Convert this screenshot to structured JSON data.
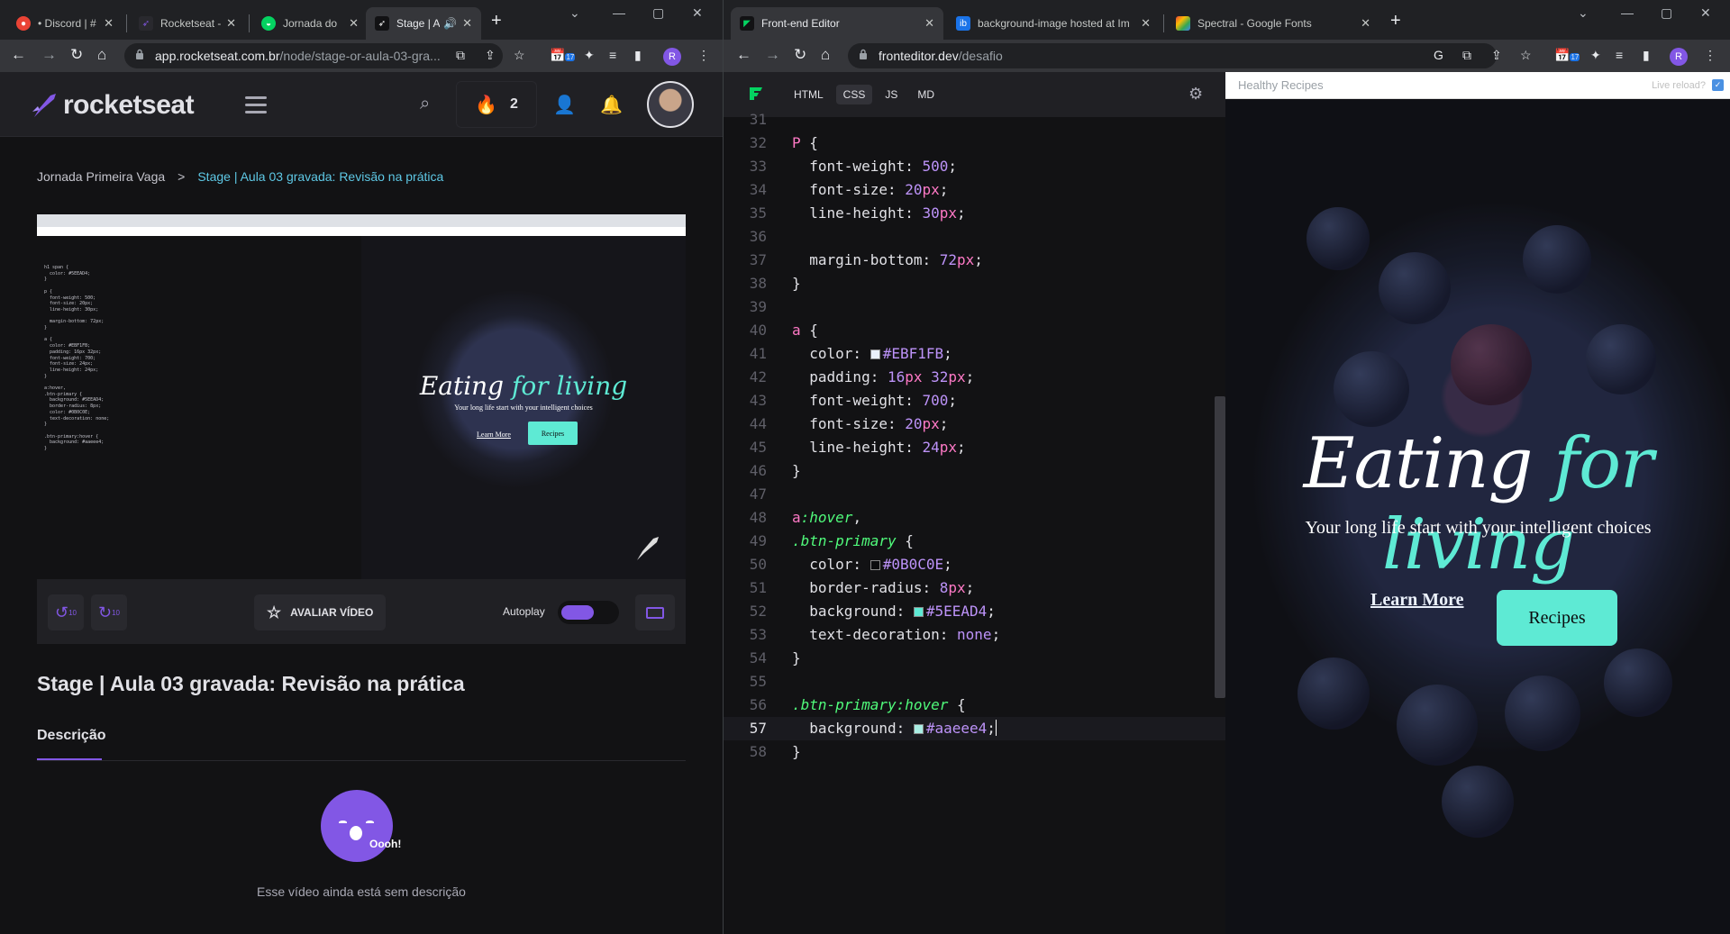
{
  "left_window": {
    "tabs": [
      {
        "title": "• Discord | #"
      },
      {
        "title": "Rocketseat -"
      },
      {
        "title": "Jornada do"
      },
      {
        "title": "Stage | A"
      }
    ],
    "url_host": "app.rocketseat.com.br",
    "url_path": "/node/stage-or-aula-03-gra...",
    "profile_initial": "R",
    "ext_badge": "17"
  },
  "rocketseat": {
    "logo": "rocketseat",
    "streak_count": "2",
    "breadcrumb": {
      "parent": "Jornada Primeira Vaga",
      "separator": ">",
      "current": "Stage | Aula 03 gravada: Revisão na prática"
    },
    "player": {
      "rate_label": "AVALIAR VÍDEO",
      "autoplay_label": "Autoplay",
      "rewind_label": "10",
      "forward_label": "10",
      "mini": {
        "hero_a": "Eating ",
        "hero_b": "for living",
        "sub": "Your long life start with your intelligent choices",
        "learn": "Learn More",
        "recipes": "Recipes",
        "code": "h1 span {\n  color: #5EEAD4;\n}\n\np {\n  font-weight: 500;\n  font-size: 20px;\n  line-height: 30px;\n\n  margin-bottom: 72px;\n}\n\na {\n  color: #EBF1FB;\n  padding: 16px 32px;\n  font-weight: 700;\n  font-size: 24px;\n  line-height: 24px;\n}\n\na:hover,\n.btn-primary {\n  background: #5EEAD4;\n  border-radius: 8px;\n  color: #0B0C0E;\n  text-decoration: none;\n}\n\n.btn-primary:hover {\n  background: #aaeee4;\n}"
      }
    },
    "lesson_title": "Stage | Aula 03 gravada: Revisão na prática",
    "description_tab": "Descrição",
    "mascot_text": "Oooh!",
    "no_description": "Esse vídeo ainda está sem descrição"
  },
  "right_window": {
    "tabs": [
      {
        "title": "Front-end Editor"
      },
      {
        "title": "background-image hosted at Im"
      },
      {
        "title": "Spectral - Google Fonts"
      }
    ],
    "url_host": "fronteditor.dev",
    "url_path": "/desafio",
    "profile_initial": "R",
    "ext_badge": "17"
  },
  "editor": {
    "tabs": [
      "HTML",
      "CSS",
      "JS",
      "MD"
    ],
    "active_tab": "CSS",
    "lines": [
      {
        "n": "31",
        "parts": []
      },
      {
        "n": "32",
        "parts": [
          {
            "t": "P ",
            "c": "sel"
          },
          {
            "t": "{",
            "c": ""
          }
        ]
      },
      {
        "n": "33",
        "parts": [
          {
            "t": "  font-weight: ",
            "c": "prop"
          },
          {
            "t": "500",
            "c": "num"
          },
          {
            "t": ";",
            "c": ""
          }
        ]
      },
      {
        "n": "34",
        "parts": [
          {
            "t": "  font-size: ",
            "c": "prop"
          },
          {
            "t": "20",
            "c": "num"
          },
          {
            "t": "px",
            "c": "unit"
          },
          {
            "t": ";",
            "c": ""
          }
        ]
      },
      {
        "n": "35",
        "parts": [
          {
            "t": "  line-height: ",
            "c": "prop"
          },
          {
            "t": "30",
            "c": "num"
          },
          {
            "t": "px",
            "c": "unit"
          },
          {
            "t": ";",
            "c": ""
          }
        ]
      },
      {
        "n": "36",
        "parts": []
      },
      {
        "n": "37",
        "parts": [
          {
            "t": "  margin-bottom: ",
            "c": "prop"
          },
          {
            "t": "72",
            "c": "num"
          },
          {
            "t": "px",
            "c": "unit"
          },
          {
            "t": ";",
            "c": ""
          }
        ]
      },
      {
        "n": "38",
        "parts": [
          {
            "t": "}",
            "c": ""
          }
        ]
      },
      {
        "n": "39",
        "parts": []
      },
      {
        "n": "40",
        "parts": [
          {
            "t": "a ",
            "c": "sel"
          },
          {
            "t": "{",
            "c": ""
          }
        ]
      },
      {
        "n": "41",
        "parts": [
          {
            "t": "  color: ",
            "c": "prop"
          },
          {
            "sw": "#EBF1FB"
          },
          {
            "t": "#EBF1FB",
            "c": "val"
          },
          {
            "t": ";",
            "c": ""
          }
        ]
      },
      {
        "n": "42",
        "parts": [
          {
            "t": "  padding: ",
            "c": "prop"
          },
          {
            "t": "16",
            "c": "num"
          },
          {
            "t": "px ",
            "c": "unit"
          },
          {
            "t": "32",
            "c": "num"
          },
          {
            "t": "px",
            "c": "unit"
          },
          {
            "t": ";",
            "c": ""
          }
        ]
      },
      {
        "n": "43",
        "parts": [
          {
            "t": "  font-weight: ",
            "c": "prop"
          },
          {
            "t": "700",
            "c": "num"
          },
          {
            "t": ";",
            "c": ""
          }
        ]
      },
      {
        "n": "44",
        "parts": [
          {
            "t": "  font-size: ",
            "c": "prop"
          },
          {
            "t": "20",
            "c": "num"
          },
          {
            "t": "px",
            "c": "unit"
          },
          {
            "t": ";",
            "c": ""
          }
        ]
      },
      {
        "n": "45",
        "parts": [
          {
            "t": "  line-height: ",
            "c": "prop"
          },
          {
            "t": "24",
            "c": "num"
          },
          {
            "t": "px",
            "c": "unit"
          },
          {
            "t": ";",
            "c": ""
          }
        ]
      },
      {
        "n": "46",
        "parts": [
          {
            "t": "}",
            "c": ""
          }
        ]
      },
      {
        "n": "47",
        "parts": []
      },
      {
        "n": "48",
        "parts": [
          {
            "t": "a",
            "c": "sel"
          },
          {
            "t": ":hover",
            "c": "sel-i"
          },
          {
            "t": ",",
            "c": ""
          }
        ]
      },
      {
        "n": "49",
        "parts": [
          {
            "t": ".btn-primary",
            "c": "sel-i"
          },
          {
            "t": " {",
            "c": ""
          }
        ]
      },
      {
        "n": "50",
        "parts": [
          {
            "t": "  color: ",
            "c": "prop"
          },
          {
            "sw": "#0B0C0E"
          },
          {
            "t": "#0B0C0E",
            "c": "val"
          },
          {
            "t": ";",
            "c": ""
          }
        ]
      },
      {
        "n": "51",
        "parts": [
          {
            "t": "  border-radius: ",
            "c": "prop"
          },
          {
            "t": "8",
            "c": "num"
          },
          {
            "t": "px",
            "c": "unit"
          },
          {
            "t": ";",
            "c": ""
          }
        ]
      },
      {
        "n": "52",
        "parts": [
          {
            "t": "  background: ",
            "c": "prop"
          },
          {
            "sw": "#5EEAD4"
          },
          {
            "t": "#5EEAD4",
            "c": "val"
          },
          {
            "t": ";",
            "c": ""
          }
        ]
      },
      {
        "n": "53",
        "parts": [
          {
            "t": "  text-decoration: ",
            "c": "prop"
          },
          {
            "t": "none",
            "c": "val"
          },
          {
            "t": ";",
            "c": ""
          }
        ]
      },
      {
        "n": "54",
        "parts": [
          {
            "t": "}",
            "c": ""
          }
        ]
      },
      {
        "n": "55",
        "parts": []
      },
      {
        "n": "56",
        "parts": [
          {
            "t": ".btn-primary:hover",
            "c": "sel-i"
          },
          {
            "t": " {",
            "c": ""
          }
        ]
      },
      {
        "n": "57",
        "parts": [
          {
            "t": "  background: ",
            "c": "prop"
          },
          {
            "sw": "#aaeee4"
          },
          {
            "t": "#aaeee4",
            "c": "val"
          },
          {
            "t": ";",
            "c": ""
          },
          {
            "caret": true
          }
        ],
        "current": true
      },
      {
        "n": "58",
        "parts": [
          {
            "t": "}",
            "c": ""
          }
        ]
      }
    ]
  },
  "preview": {
    "title": "Healthy Recipes",
    "live_reload": "Live reload?",
    "hero_a": "Eating ",
    "hero_b": "for living",
    "subtitle": "Your long life start with your intelligent choices",
    "learn_more": "Learn More",
    "recipes": "Recipes"
  },
  "colors": {
    "accent_purple": "#8257e5",
    "teal": "#5EEAD4"
  }
}
